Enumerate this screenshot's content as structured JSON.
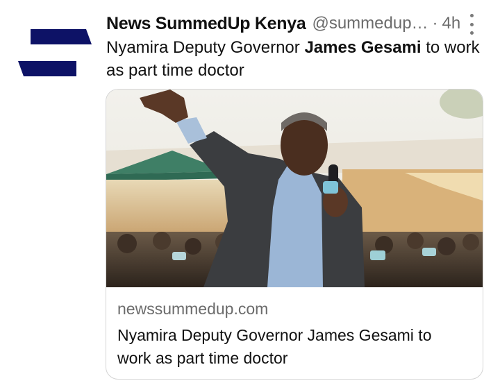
{
  "tweet": {
    "author_name": "News SummedUp Kenya",
    "handle": "@summedup…",
    "separator": "·",
    "time": "4h",
    "text_before": "Nyamira Deputy Governor ",
    "text_bold": "James Gesami",
    "text_after": " to work as part time doctor"
  },
  "card": {
    "domain": "newssummedup.com",
    "title": "Nyamira Deputy Governor James Gesami to work as part time doctor",
    "image_icon": "photo-man-raising-hand-holding-microphone"
  },
  "icons": {
    "avatar": "summedup-logo-icon",
    "more": "more-vertical-icon"
  },
  "colors": {
    "logo_navy": "#0d1266",
    "secondary_text": "#6b6b6b",
    "card_border": "#d4d4d4"
  }
}
